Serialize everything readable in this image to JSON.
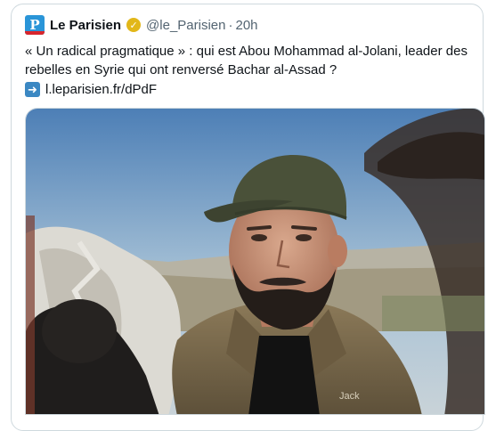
{
  "tweet": {
    "author_name": "Le Parisien",
    "avatar_letter": "P",
    "handle": "@le_Parisien",
    "separator": "·",
    "time": "20h",
    "text_line": "« Un radical pragmatique » : qui est Abou Mohammad al-Jolani, leader des rebelles en Syrie qui ont renversé Bachar al-Assad ?",
    "link_text": "l.leparisien.fr/dPdF",
    "verified_icon": "verified-badge-icon",
    "link_icon": "right-arrow-icon"
  },
  "media": {
    "jacket_logo_text": "Jack"
  },
  "colors": {
    "brand": "#2a95d8",
    "badge": "#e2b719",
    "border": "#cfd9de",
    "muted": "#536471"
  }
}
